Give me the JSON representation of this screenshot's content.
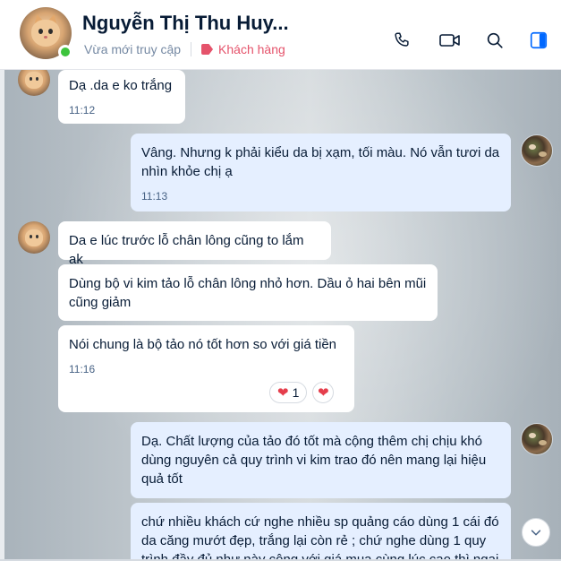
{
  "header": {
    "contact_name": "Nguyễn Thị Thu Huy...",
    "status": "Vừa mới truy cập",
    "tag_label": "Khách hàng",
    "tag_color": "#e5536b",
    "online_color": "#3dc43d",
    "actions": [
      "phone-icon",
      "video-call-icon",
      "search-icon",
      "sidebar-toggle-icon"
    ]
  },
  "messages": [
    {
      "direction": "in",
      "text": "Dạ .da e ko trắng",
      "time": "11:12"
    },
    {
      "direction": "out",
      "text": "Vâng. Nhưng k phải kiểu da bị xạm, tối màu. Nó vẫn tươi da nhìn khỏe chị ạ",
      "time": "11:13"
    },
    {
      "direction": "in",
      "text": "Da e lúc trước lỗ chân lông cũng to lắm ak"
    },
    {
      "direction": "in",
      "text": "Dùng bộ vi kim tảo lỗ chân lông nhỏ hơn.  Dầu ỏ hai bên mũi cũng giảm"
    },
    {
      "direction": "in",
      "text": "Nói chung là bộ tảo nó tốt hơn so với giá tiền",
      "time": "11:16",
      "reaction_count": "1"
    },
    {
      "direction": "out",
      "text": "Dạ. Chất lượng của tảo đó tốt mà cộng thêm chị chịu khó dùng nguyên cả quy trình vi kim trao đó nên mang lại hiệu quả tốt"
    },
    {
      "direction": "out",
      "text": "chứ nhiều khách cứ nghe nhiều sp quảng cáo dùng 1 cái đó da căng mướt đẹp, trắng lại còn rẻ ; chứ nghe dùng 1 quy trình đầy đủ như này cộng với giá mua cùng lúc cao thì ngại"
    }
  ],
  "colors": {
    "incoming_bubble": "#ffffff",
    "outgoing_bubble": "#e5efff",
    "accent": "#0068ff",
    "reaction_heart": "#e53e4c"
  }
}
